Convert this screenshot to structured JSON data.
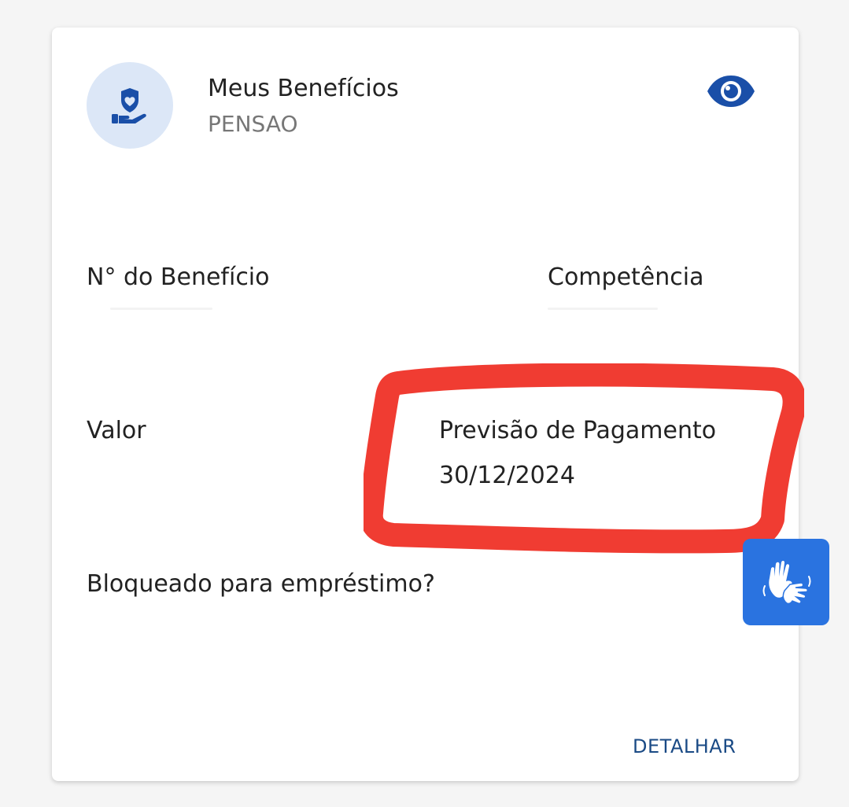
{
  "header": {
    "title": "Meus Benefícios",
    "subtitle": "PENSAO"
  },
  "icons": {
    "benefit": "hand-shield-heart-icon",
    "visibility": "eye-icon",
    "accessibility": "sign-language-hands-icon"
  },
  "fields": {
    "beneficio_label": "N° do Benefício",
    "competencia_label": "Competência",
    "valor_label": "Valor",
    "previsao_label": "Previsão de Pagamento",
    "previsao_value": "30/12/2024",
    "bloqueado_label": "Bloqueado para empréstimo?"
  },
  "actions": {
    "detalhar": "DETALHAR"
  },
  "colors": {
    "accent": "#1a4fa8",
    "annotation": "#f03c32",
    "vlibras": "#2a73e0"
  }
}
